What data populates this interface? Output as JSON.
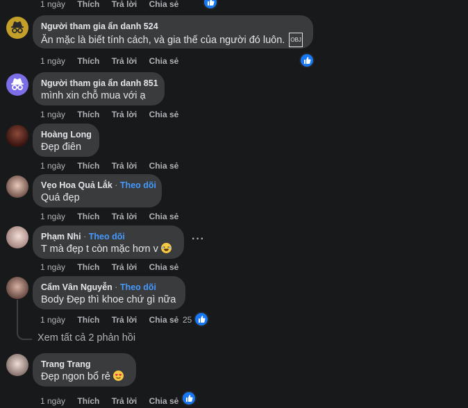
{
  "comments": [
    {
      "name": "",
      "text": "",
      "meta": {
        "time": "1 ngày",
        "like": "Thích",
        "reply": "Trả lời",
        "share": "Chia sẻ"
      }
    },
    {
      "name": "Người tham gia ẩn danh 524",
      "text": "Ăn mặc là biết tính cách, và gia thế của người đó luôn.",
      "meta": {
        "time": "1 ngày",
        "like": "Thích",
        "reply": "Trả lời",
        "share": "Chia sẻ"
      }
    },
    {
      "name": "Người tham gia ẩn danh 851",
      "text": "mình xin chỗ mua với ạ",
      "meta": {
        "time": "1 ngày",
        "like": "Thích",
        "reply": "Trả lời",
        "share": "Chia sẻ"
      }
    },
    {
      "name": "Hoàng Long",
      "text": "Đẹp điên",
      "meta": {
        "time": "1 ngày",
        "like": "Thích",
        "reply": "Trả lời",
        "share": "Chia sẻ"
      }
    },
    {
      "name": "Vẹo Hoa Quả Lắk",
      "follow": "Theo dõi",
      "text": "Quá đẹp",
      "meta": {
        "time": "1 ngày",
        "like": "Thích",
        "reply": "Trả lời",
        "share": "Chia sẻ"
      }
    },
    {
      "name": "Phạm Nhi",
      "follow": "Theo dõi",
      "text": "T mà đẹp t còn mặc hơn v",
      "meta": {
        "time": "1 ngày",
        "like": "Thích",
        "reply": "Trả lời",
        "share": "Chia sẻ"
      }
    },
    {
      "name": "Cẩm Vân Nguyễn",
      "follow": "Theo dõi",
      "text": "Body Đẹp thì khoe chứ gì nữa",
      "reaction_count": "25",
      "meta": {
        "time": "1 ngày",
        "like": "Thích",
        "reply": "Trả lời",
        "share": "Chia sẻ"
      }
    },
    {
      "name": "Trang Trang",
      "text": "Đẹp ngon bổ rẻ",
      "meta": {
        "time": "1 ngày",
        "like": "Thích",
        "reply": "Trả lời",
        "share": "Chia sẻ"
      }
    }
  ],
  "view_replies": "Xem tất cả 2 phản hồi",
  "colors": {
    "background": "#18191a",
    "bubble": "#3a3b3c",
    "accent": "#4599ff",
    "like": "#1877f2",
    "muted": "#b0b3b8"
  },
  "icons": [
    "anonymous-icon",
    "like-reaction-icon",
    "laughing-emoji-icon",
    "heart-eyes-emoji-icon",
    "more-options-icon",
    "reply-connector-icon"
  ]
}
